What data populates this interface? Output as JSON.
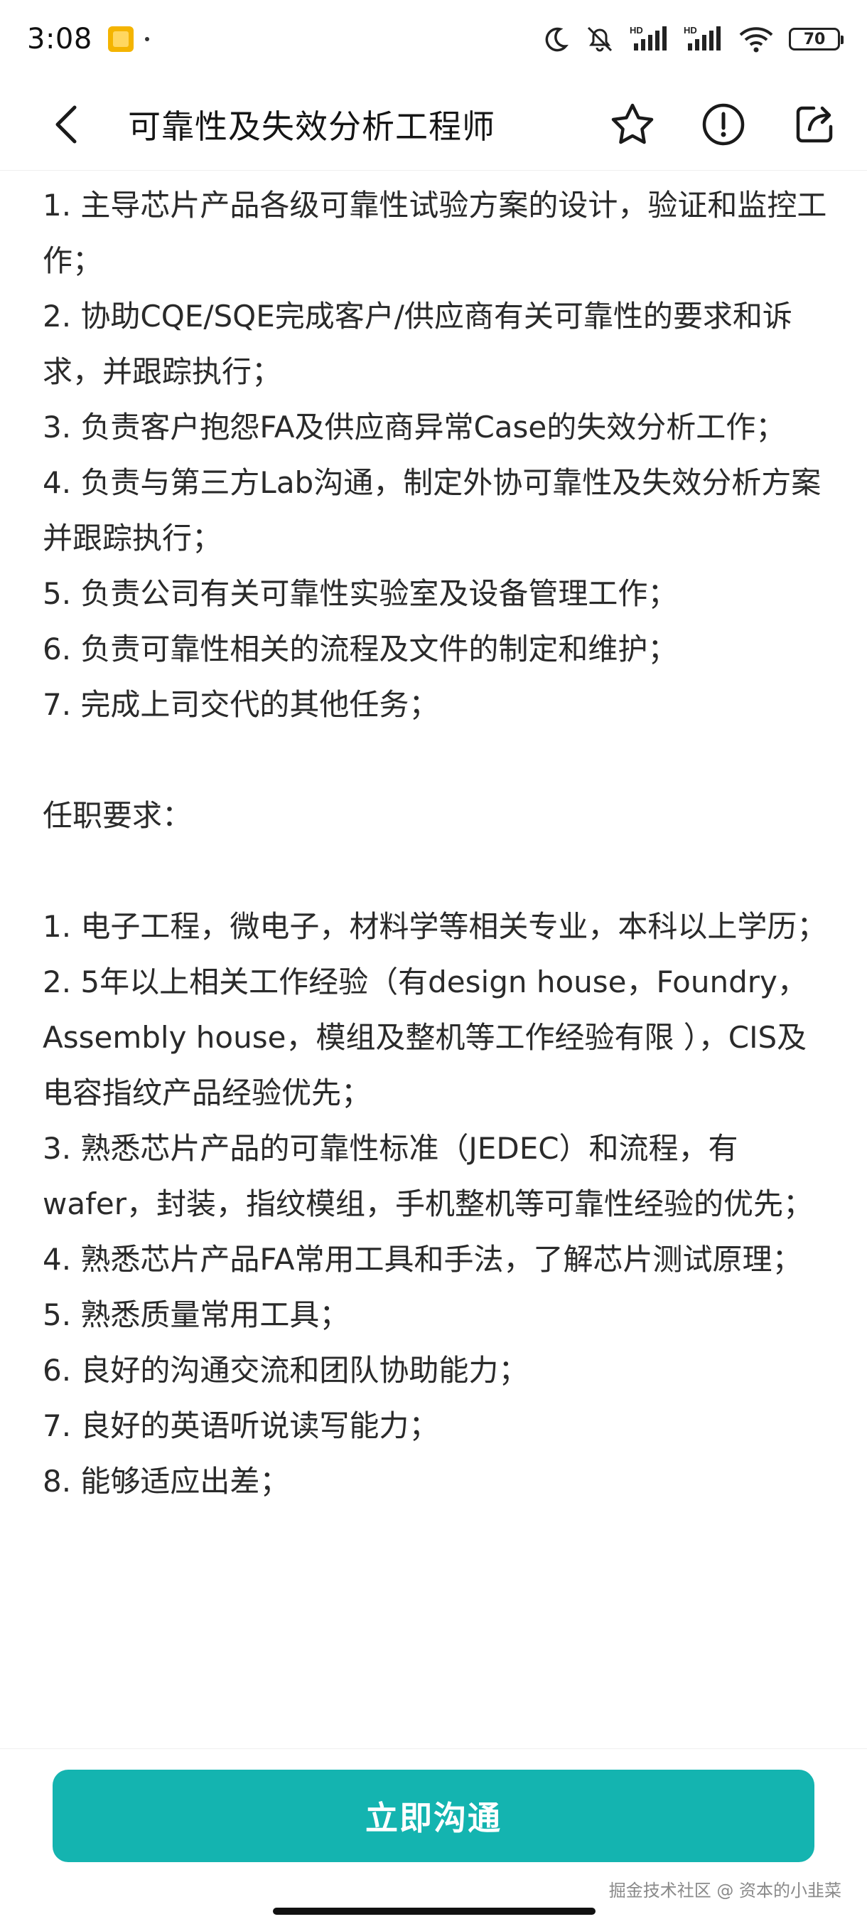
{
  "status_bar": {
    "time": "3:08",
    "battery": "70",
    "signal_labels": [
      "HD",
      "HD"
    ]
  },
  "header": {
    "title": "可靠性及失效分析工程师",
    "icons": [
      "back-chevron-icon",
      "star-icon",
      "warning-icon",
      "share-icon"
    ]
  },
  "content": {
    "lines": [
      "1. 主导芯片产品各级可靠性试验方案的设计，验证和监控工作；",
      "2. 协助CQE/SQE完成客户/供应商有关可靠性的要求和诉求，并跟踪执行；",
      "3. 负责客户抱怨FA及供应商异常Case的失效分析工作；",
      "4. 负责与第三方Lab沟通，制定外协可靠性及失效分析方案并跟踪执行；",
      "5. 负责公司有关可靠性实验室及设备管理工作；",
      "6. 负责可靠性相关的流程及文件的制定和维护；",
      "7. 完成上司交代的其他任务；",
      "",
      "任职要求：",
      "",
      "1. 电子工程，微电子，材料学等相关专业，本科以上学历；",
      "2. 5年以上相关工作经验（有design house，Foundry，Assembly house，模组及整机等工作经验有限 ），CIS及电容指纹产品经验优先；",
      "3. 熟悉芯片产品的可靠性标准（JEDEC）和流程，有wafer，封装，指纹模组，手机整机等可靠性经验的优先；",
      "4. 熟悉芯片产品FA常用工具和手法，了解芯片测试原理；",
      "5. 熟悉质量常用工具；",
      "6. 良好的沟通交流和团队协助能力；",
      "7. 良好的英语听说读写能力；",
      "8. 能够适应出差；"
    ]
  },
  "cta": {
    "label": "立即沟通",
    "color": "#14b4b0"
  },
  "watermark": "掘金技术社区 @ 资本的小韭菜"
}
